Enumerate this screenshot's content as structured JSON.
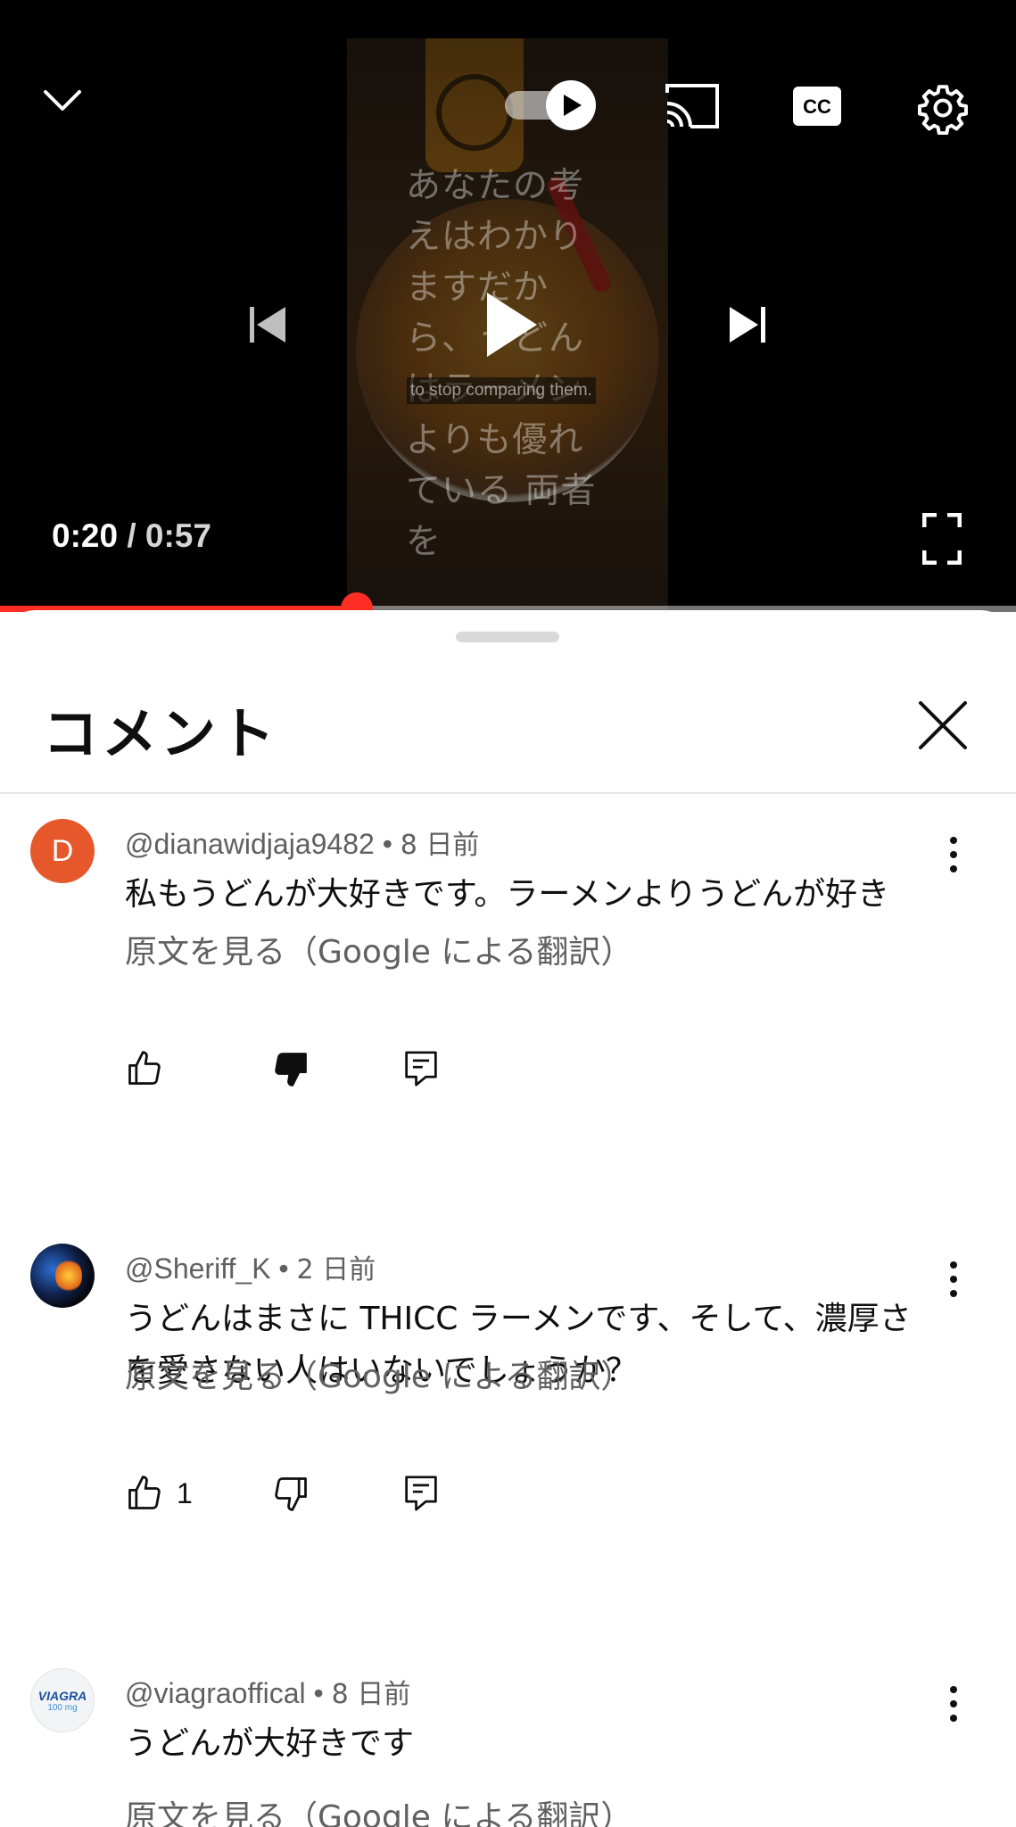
{
  "player": {
    "subtitle_jp": "あなたの考えはわかりますだから、うどんはラーメンよりも優れている 両者を",
    "subtitle_en": "to stop comparing them.",
    "time_current": "0:20",
    "time_separator": "/",
    "time_total": "0:57",
    "progress_fraction": 0.351,
    "accent_color": "#ff2e24"
  },
  "comments_panel": {
    "title": "コメント",
    "items": [
      {
        "avatar_letter": "D",
        "author": "@dianawidjaja9482",
        "separator": "•",
        "age": "8 日前",
        "text": "私もうどんが大好きです。ラーメンよりうどんが好き",
        "translate_label": "原文を見る（Google による翻訳）",
        "like_count": "",
        "disliked": true
      },
      {
        "author": "@Sheriff_K",
        "separator": "•",
        "age": "2 日前",
        "text": "うどんはまさに THICC ラーメンです、そして、濃厚さを愛さない人はいないでしょうか？",
        "translate_label": "原文を見る（Google による翻訳）",
        "like_count": "1",
        "disliked": false
      },
      {
        "avatar_text": "VIAGRA",
        "avatar_subtext": "100 mg",
        "author": "@viagraoffical",
        "separator": "•",
        "age": "8 日前",
        "text": "うどんが大好きです",
        "translate_label": "原文を見る（Google による翻訳）"
      }
    ]
  }
}
